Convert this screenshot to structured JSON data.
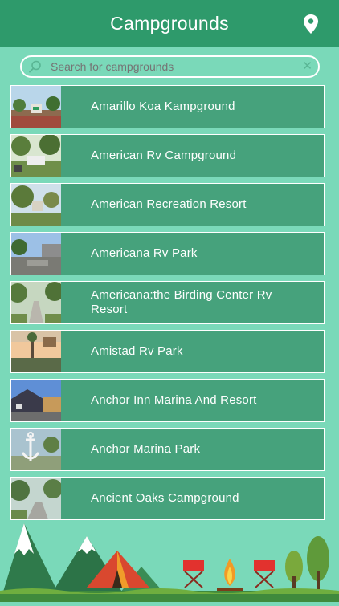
{
  "header": {
    "title": "Campgrounds",
    "map_icon": "location-pin-icon"
  },
  "search": {
    "placeholder": "Search for campgrounds",
    "search_icon": "magnifier-icon",
    "clear_icon": "close-icon",
    "clear_glyph": "✕"
  },
  "list": {
    "items": [
      {
        "name": "Amarillo Koa Kampground"
      },
      {
        "name": "American Rv Campground"
      },
      {
        "name": "American Recreation Resort"
      },
      {
        "name": "Americana Rv Park"
      },
      {
        "name": "Americana:the Birding Center Rv Resort"
      },
      {
        "name": "Amistad Rv Park"
      },
      {
        "name": "Anchor Inn Marina And Resort"
      },
      {
        "name": "Anchor Marina Park"
      },
      {
        "name": "Ancient Oaks Campground"
      }
    ]
  },
  "colors": {
    "header": "#2e9a6b",
    "background": "#7ad9b9",
    "row": "#46a27c",
    "row_border": "#ffffff"
  }
}
